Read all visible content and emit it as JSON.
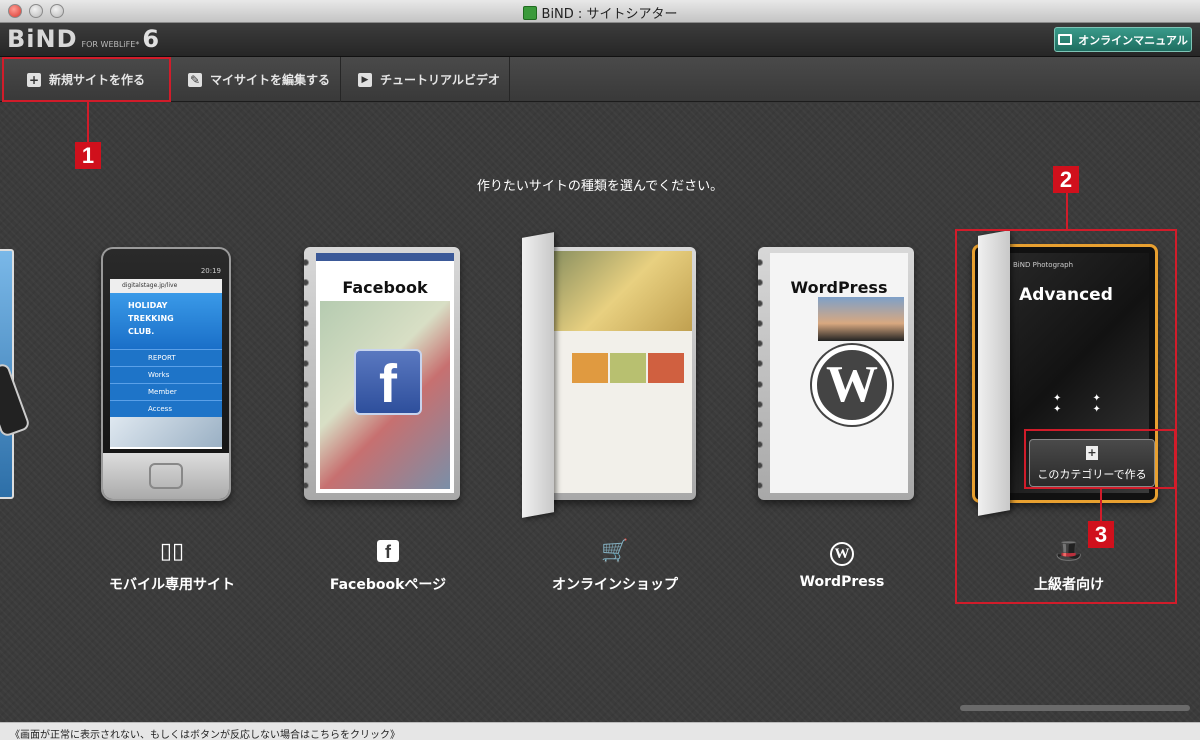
{
  "window": {
    "title": "BiND : サイトシアター"
  },
  "app": {
    "logo": {
      "main": "BiND",
      "sub": "FOR WEBLiFE*",
      "version": "6"
    },
    "manual_button": "オンラインマニュアル"
  },
  "toolbar": {
    "new_site": "新規サイトを作る",
    "edit_site": "マイサイトを編集する",
    "tutorial": "チュートリアルビデオ"
  },
  "main": {
    "prompt": "作りたいサイトの種類を選んでください。",
    "categories": [
      {
        "label": "モバイル専用サイト",
        "icon": "mobile-icon"
      },
      {
        "label": "Facebookページ",
        "icon": "facebook-icon"
      },
      {
        "label": "オンラインショップ",
        "icon": "cart-icon"
      },
      {
        "label": "WordPress",
        "icon": "wordpress-icon"
      },
      {
        "label": "上級者向け",
        "icon": "magic-hat-icon"
      }
    ],
    "cards": {
      "mobile": {
        "url": "digitalstage.jp/live",
        "headline": [
          "HOLIDAY",
          "TREKKING",
          "CLUB."
        ],
        "menu": [
          "REPORT",
          "Works",
          "Member",
          "Access"
        ],
        "time": "20:19"
      },
      "facebook": {
        "title": "Facebook"
      },
      "shop": {},
      "wordpress": {
        "title": "WordPress"
      },
      "advanced": {
        "title": "Advanced",
        "subtitle": "BiND Photograph",
        "create_button": "このカテゴリーで作る"
      }
    }
  },
  "annotations": {
    "badge1": "1",
    "badge2": "2",
    "badge3": "3"
  },
  "status": "《画面が正常に表示されない、もしくはボタンが反応しない場合はこちらをクリック》",
  "colors": {
    "accent_red": "#d11c2a",
    "selection_orange": "#e8a030",
    "manual_teal": "#2a8474"
  }
}
